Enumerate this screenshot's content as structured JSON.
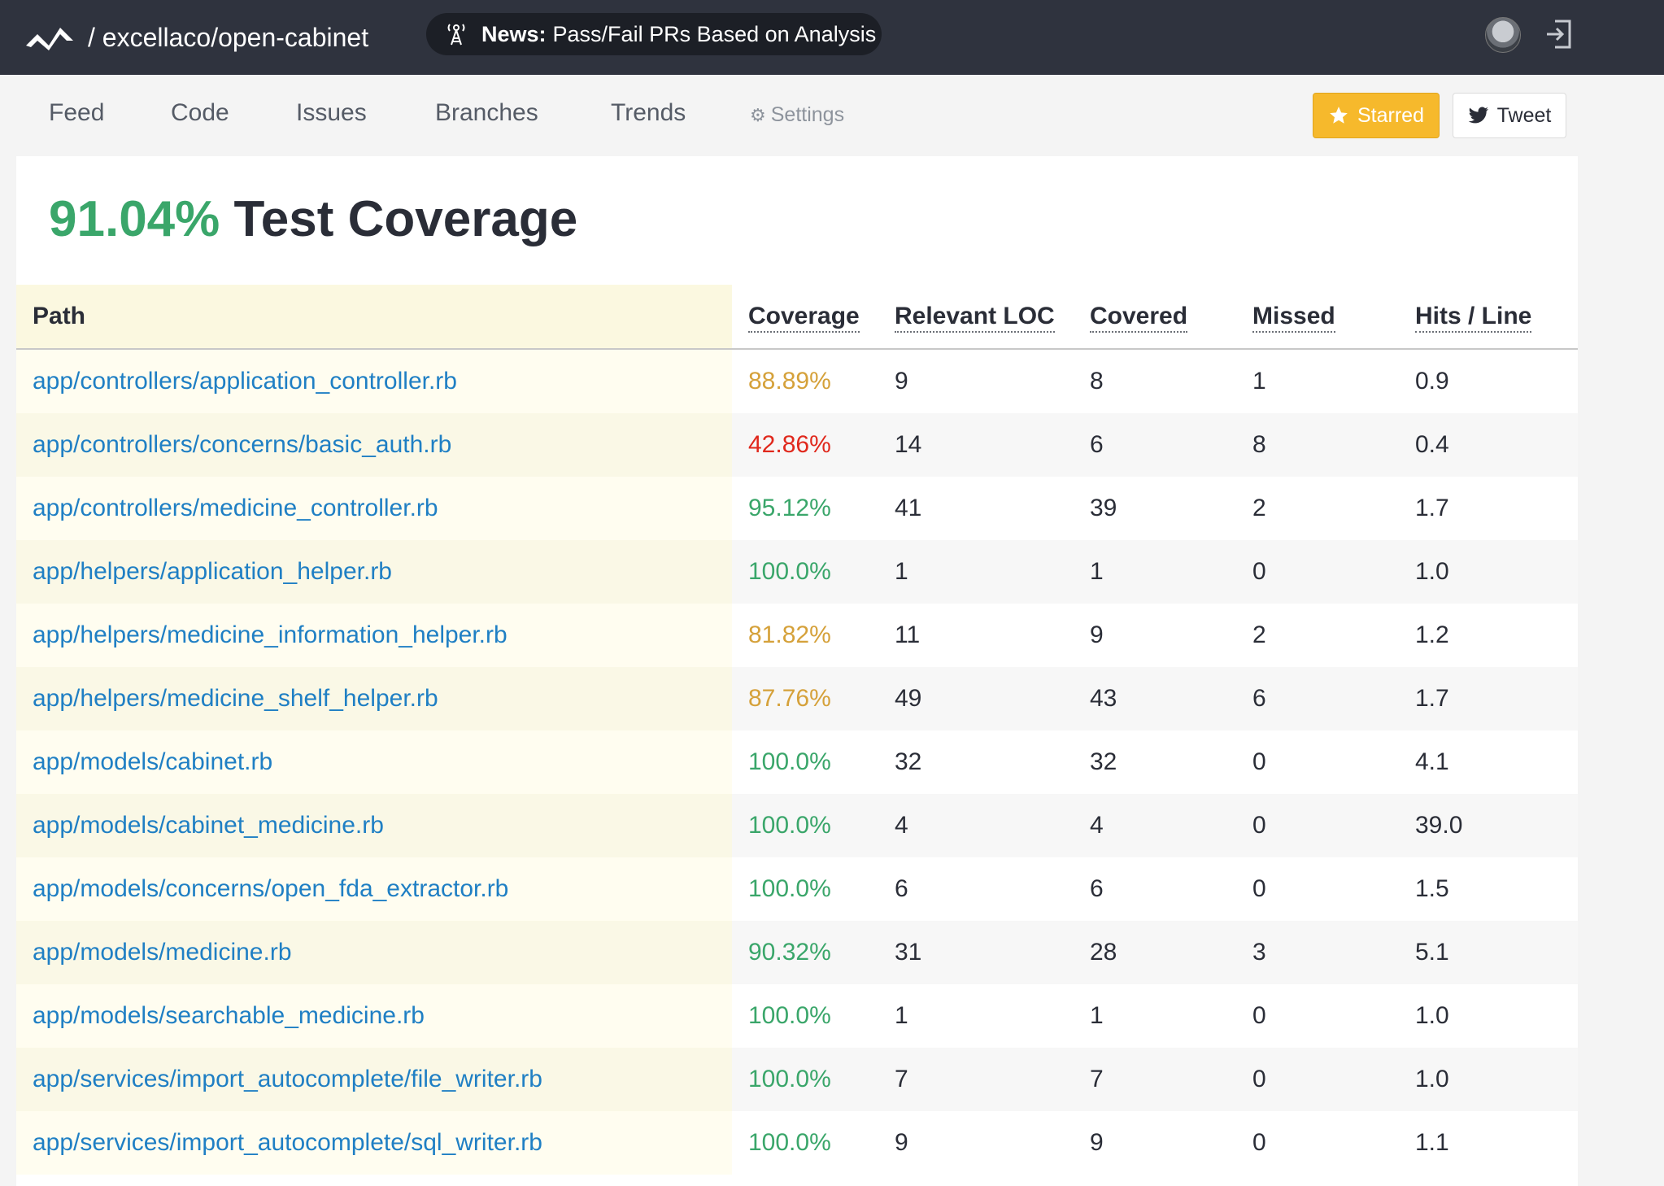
{
  "header": {
    "repo_path": "/ excellaco/open-cabinet",
    "news_label": "News:",
    "news_text": "Pass/Fail PRs Based on Analysis"
  },
  "nav": {
    "items": [
      {
        "label": "Feed"
      },
      {
        "label": "Code"
      },
      {
        "label": "Issues"
      },
      {
        "label": "Branches"
      },
      {
        "label": "Trends"
      }
    ],
    "settings_label": "Settings",
    "starred_label": "Starred",
    "tweet_label": "Tweet"
  },
  "summary": {
    "coverage_percent": "91.04%",
    "title": "Test Coverage"
  },
  "table": {
    "columns": [
      "Path",
      "Coverage",
      "Relevant LOC",
      "Covered",
      "Missed",
      "Hits / Line"
    ],
    "rows": [
      {
        "path": "app/controllers/application_controller.rb",
        "coverage": "88.89%",
        "status": "amber",
        "relevant": "9",
        "covered": "8",
        "missed": "1",
        "hits": "0.9"
      },
      {
        "path": "app/controllers/concerns/basic_auth.rb",
        "coverage": "42.86%",
        "status": "red",
        "relevant": "14",
        "covered": "6",
        "missed": "8",
        "hits": "0.4"
      },
      {
        "path": "app/controllers/medicine_controller.rb",
        "coverage": "95.12%",
        "status": "green",
        "relevant": "41",
        "covered": "39",
        "missed": "2",
        "hits": "1.7"
      },
      {
        "path": "app/helpers/application_helper.rb",
        "coverage": "100.0%",
        "status": "green",
        "relevant": "1",
        "covered": "1",
        "missed": "0",
        "hits": "1.0"
      },
      {
        "path": "app/helpers/medicine_information_helper.rb",
        "coverage": "81.82%",
        "status": "amber",
        "relevant": "11",
        "covered": "9",
        "missed": "2",
        "hits": "1.2"
      },
      {
        "path": "app/helpers/medicine_shelf_helper.rb",
        "coverage": "87.76%",
        "status": "amber",
        "relevant": "49",
        "covered": "43",
        "missed": "6",
        "hits": "1.7"
      },
      {
        "path": "app/models/cabinet.rb",
        "coverage": "100.0%",
        "status": "green",
        "relevant": "32",
        "covered": "32",
        "missed": "0",
        "hits": "4.1"
      },
      {
        "path": "app/models/cabinet_medicine.rb",
        "coverage": "100.0%",
        "status": "green",
        "relevant": "4",
        "covered": "4",
        "missed": "0",
        "hits": "39.0"
      },
      {
        "path": "app/models/concerns/open_fda_extractor.rb",
        "coverage": "100.0%",
        "status": "green",
        "relevant": "6",
        "covered": "6",
        "missed": "0",
        "hits": "1.5"
      },
      {
        "path": "app/models/medicine.rb",
        "coverage": "90.32%",
        "status": "green",
        "relevant": "31",
        "covered": "28",
        "missed": "3",
        "hits": "5.1"
      },
      {
        "path": "app/models/searchable_medicine.rb",
        "coverage": "100.0%",
        "status": "green",
        "relevant": "1",
        "covered": "1",
        "missed": "0",
        "hits": "1.0"
      },
      {
        "path": "app/services/import_autocomplete/file_writer.rb",
        "coverage": "100.0%",
        "status": "green",
        "relevant": "7",
        "covered": "7",
        "missed": "0",
        "hits": "1.0"
      },
      {
        "path": "app/services/import_autocomplete/sql_writer.rb",
        "coverage": "100.0%",
        "status": "green",
        "relevant": "9",
        "covered": "9",
        "missed": "0",
        "hits": "1.1"
      }
    ]
  },
  "colors": {
    "topbar": "#2f333e",
    "green": "#3aa66a",
    "amber": "#d5a13a",
    "red": "#e0281c",
    "link": "#1f7fc4",
    "starred": "#f6b92c"
  },
  "icons": [
    "codeclimate-logo-icon",
    "tower-icon",
    "user-avatar",
    "sign-in-icon",
    "gear-icon",
    "star-icon",
    "twitter-bird-icon"
  ]
}
